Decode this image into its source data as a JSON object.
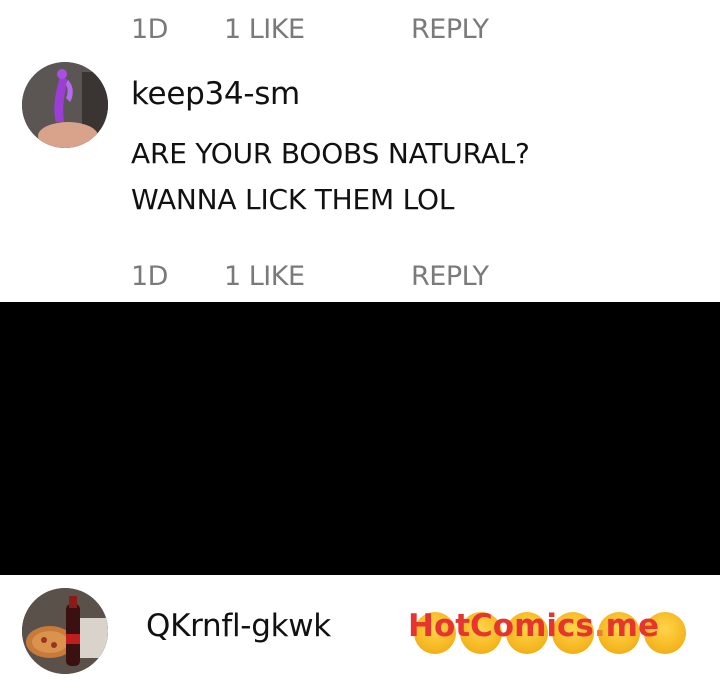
{
  "top_meta": {
    "time": "1D",
    "likes": "1 LIKE",
    "reply": "REPLY"
  },
  "comment1": {
    "username": "keep34-sm",
    "lines": [
      "ARE YOUR BOOBS NATURAL?",
      "WANNA LICK THEM LOL"
    ],
    "meta": {
      "time": "1D",
      "likes": "1 LIKE",
      "reply": "REPLY"
    }
  },
  "comment2": {
    "username": "QKrnfl-gkwk"
  },
  "watermark": {
    "brand": "HotComics",
    "dot": ".",
    "tld": "me"
  },
  "colors": {
    "meta_text": "#7a7a7a",
    "body_text": "#111111",
    "censor_block": "#000000",
    "watermark": "#e5352e"
  },
  "icons": {
    "avatar1": "avatar-purple-toy",
    "avatar2": "avatar-pizza-bottle",
    "emoji": "heart-eyes-emoji"
  }
}
